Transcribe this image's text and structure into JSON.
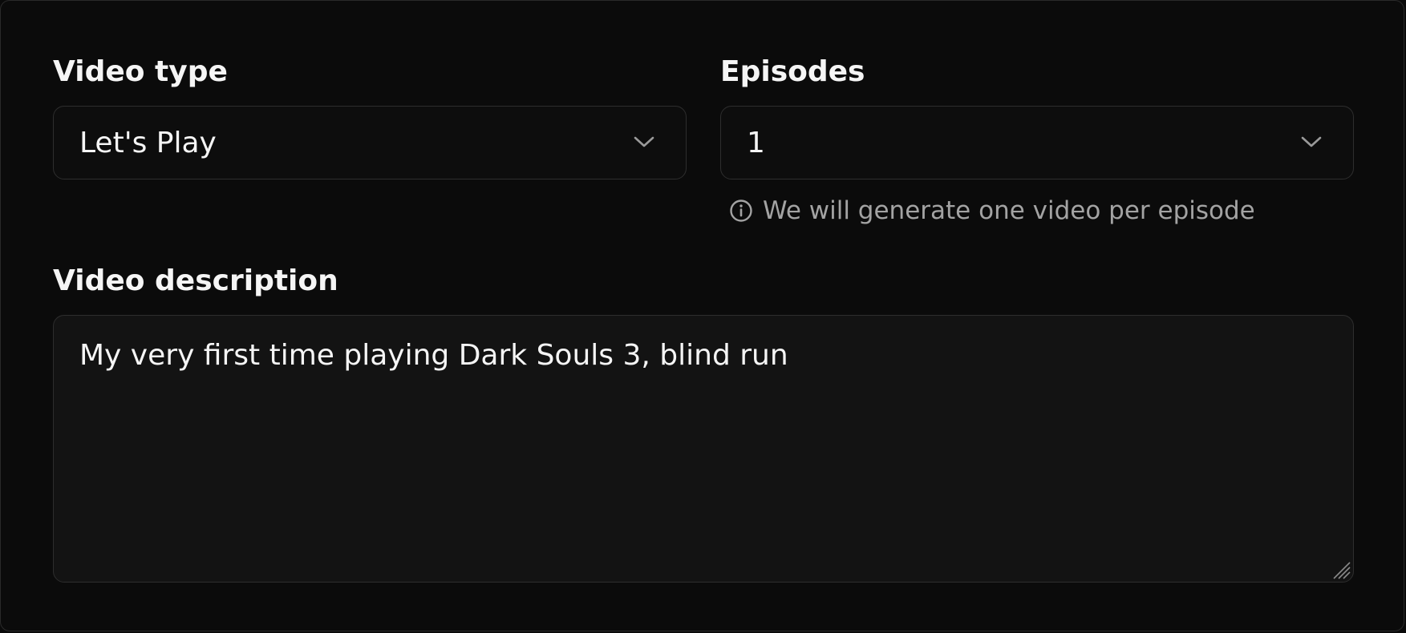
{
  "form": {
    "video_type": {
      "label": "Video type",
      "value": "Let's Play",
      "icon": "chevron-down-icon"
    },
    "episodes": {
      "label": "Episodes",
      "value": "1",
      "icon": "chevron-down-icon",
      "hint": "We will generate one video per episode",
      "hint_icon": "info-icon"
    },
    "video_description": {
      "label": "Video description",
      "value": "My very first time playing Dark Souls 3, blind run"
    }
  },
  "colors": {
    "background": "#0b0b0b",
    "text": "#f5f5f5",
    "muted": "#a3a3a3",
    "border": "#2e2e2e"
  }
}
